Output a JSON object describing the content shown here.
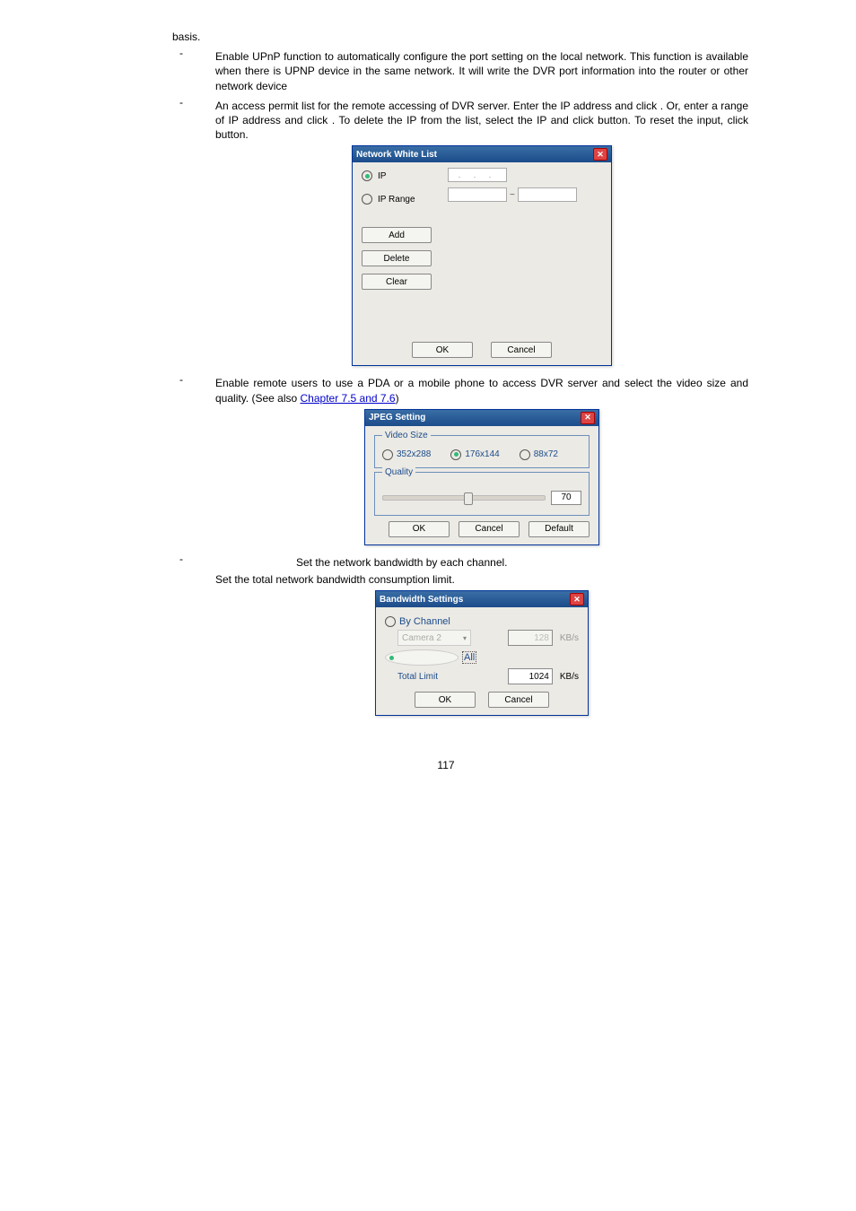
{
  "page": {
    "basis_line": "basis.",
    "number": "117"
  },
  "items": {
    "upnp": {
      "body": "Enable UPnP function to automatically configure the port setting on the local network. This function is available when there is UPNP device in the same network. It will write the DVR port information into the router or other network device"
    },
    "whitelist": {
      "p1_a": "An access permit list for the remote accessing of DVR server. Enter the IP address and click ",
      "p1_b": ". Or, enter a range of IP address and click ",
      "p1_c": ". To delete the IP from the list, select the IP and click ",
      "p1_d": " button. To reset the input, click ",
      "p1_e": " button."
    },
    "jpeg": {
      "p1_a": "Enable remote users to use a PDA or a mobile phone to access DVR server and select the video size and quality. (See also ",
      "link": "Chapter 7.5 and 7.6",
      "p1_b": ")"
    },
    "bandwidth": {
      "line1": "Set the network bandwidth by each channel.",
      "line2": "Set the total network bandwidth consumption limit."
    }
  },
  "dlg_whitelist": {
    "title": "Network White List",
    "ip_label": "IP",
    "iprange_label": "IP Range",
    "add": "Add",
    "delete": "Delete",
    "clear": "Clear",
    "ok": "OK",
    "cancel": "Cancel",
    "ip_placeholder": ".   .   ."
  },
  "dlg_jpeg": {
    "title": "JPEG Setting",
    "videosize_legend": "Video Size",
    "size1": "352x288",
    "size2": "176x144",
    "size3": "88x72",
    "quality_legend": "Quality",
    "quality_value": "70",
    "ok": "OK",
    "cancel": "Cancel",
    "default": "Default"
  },
  "dlg_bw": {
    "title": "Bandwidth Settings",
    "by_channel": "By Channel",
    "camera_sel": "Camera 2",
    "bychannel_val": "128",
    "all": "All",
    "total_limit": "Total Limit",
    "total_val": "1024",
    "unit": "KB/s",
    "ok": "OK",
    "cancel": "Cancel"
  }
}
